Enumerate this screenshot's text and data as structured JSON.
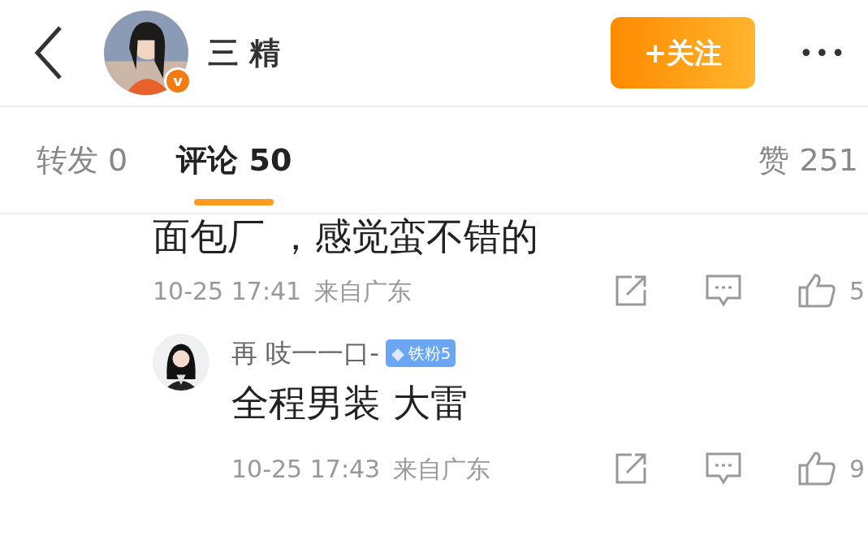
{
  "header": {
    "name": "三 精",
    "verified_badge": "v",
    "follow_button": "+关注",
    "more": "•••"
  },
  "tabs": [
    {
      "label": "转发 0",
      "selected": false
    },
    {
      "label": "评论 50",
      "selected": true
    }
  ],
  "likes": "赞 251",
  "comments": [
    {
      "text": "面包厂 ，感觉蛮不错的",
      "time": "10-25 17:41",
      "location": "来自广东",
      "like_count": "5"
    },
    {
      "user": "再 吱一一口-",
      "fan_badge": "铁粉5",
      "text": "全程男装 大雷",
      "time": "10-25 17:43",
      "location": "来自广东",
      "like_count": "9"
    }
  ]
}
